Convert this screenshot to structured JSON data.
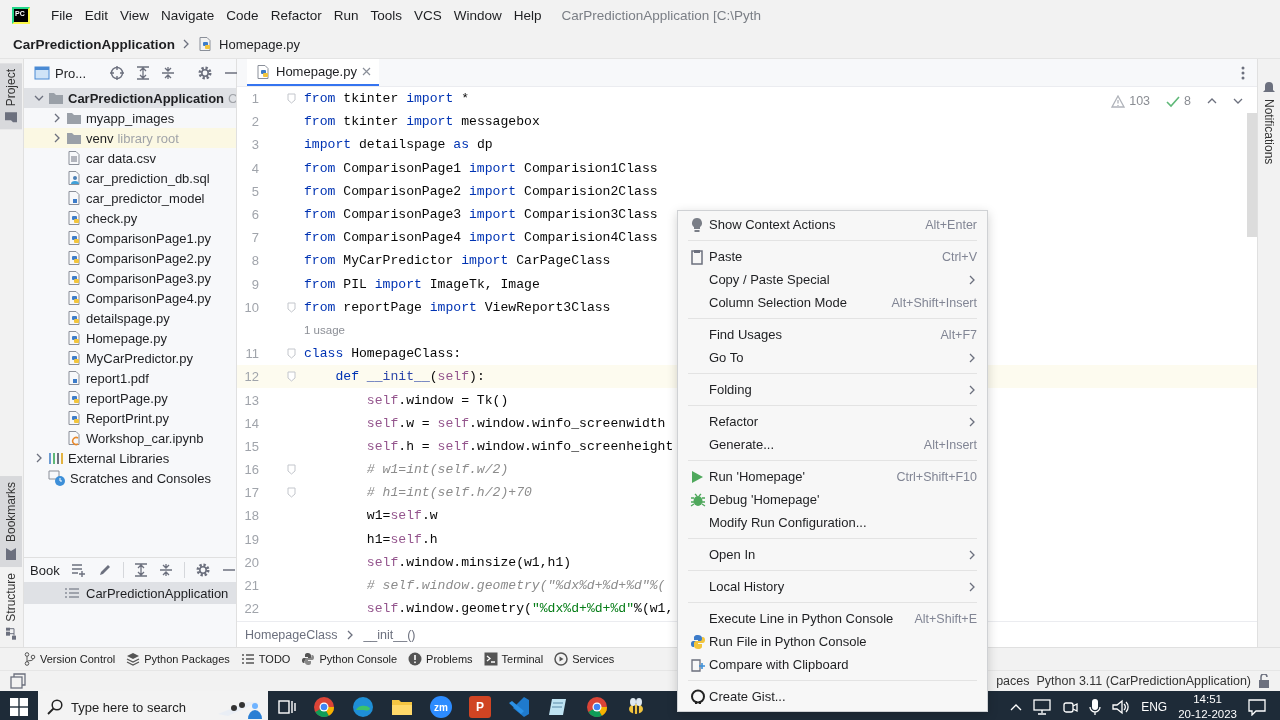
{
  "menubar": {
    "logo_text": "PC",
    "items": [
      "File",
      "Edit",
      "View",
      "Navigate",
      "Code",
      "Refactor",
      "Run",
      "Tools",
      "VCS",
      "Window",
      "Help"
    ],
    "title": "CarPredictionApplication [C:\\Pyth"
  },
  "breadcrumb": {
    "project": "CarPredictionApplication",
    "file": "Homepage.py"
  },
  "left_stripe": [
    {
      "label": "Project",
      "kind": "project",
      "active": true
    },
    {
      "label": "Bookmarks",
      "kind": "bookmarks",
      "active": true
    },
    {
      "label": "Structure",
      "kind": "structure",
      "active": false
    }
  ],
  "project_panel": {
    "title": "Pro...",
    "tree": [
      {
        "label": "CarPredictionApplication",
        "hint": "C",
        "kind": "project-folder",
        "expanded": true,
        "selected": true,
        "children": [
          {
            "label": "myapp_images",
            "kind": "folder",
            "expanded": false,
            "selected": false
          },
          {
            "label": "venv",
            "hint": "library root",
            "kind": "library-folder",
            "expanded": false,
            "selected": false
          },
          {
            "label": "car data.csv",
            "kind": "text",
            "selected": false
          },
          {
            "label": "car_prediction_db.sql",
            "kind": "sql",
            "selected": false
          },
          {
            "label": "car_predictor_model",
            "kind": "unknown",
            "selected": false
          },
          {
            "label": "check.py",
            "kind": "python",
            "selected": false
          },
          {
            "label": "ComparisonPage1.py",
            "kind": "python",
            "selected": false
          },
          {
            "label": "ComparisonPage2.py",
            "kind": "python",
            "selected": false
          },
          {
            "label": "ComparisonPage3.py",
            "kind": "python",
            "selected": false
          },
          {
            "label": "ComparisonPage4.py",
            "kind": "python",
            "selected": false
          },
          {
            "label": "detailspage.py",
            "kind": "python",
            "selected": false
          },
          {
            "label": "Homepage.py",
            "kind": "python",
            "selected": false
          },
          {
            "label": "MyCarPredictor.py",
            "kind": "python",
            "selected": false
          },
          {
            "label": "report1.pdf",
            "kind": "unknown",
            "selected": false
          },
          {
            "label": "reportPage.py",
            "kind": "python",
            "selected": false
          },
          {
            "label": "ReportPrint.py",
            "kind": "python",
            "selected": false
          },
          {
            "label": "Workshop_car.ipynb",
            "kind": "notebook",
            "selected": false
          }
        ]
      },
      {
        "label": "External Libraries",
        "kind": "libraries",
        "expanded": false,
        "selected": false
      },
      {
        "label": "Scratches and Consoles",
        "kind": "scratches",
        "selected": false
      }
    ]
  },
  "bookmarks_panel": {
    "title": "Book",
    "items": [
      {
        "label": "CarPredictionApplication",
        "selected": true
      }
    ]
  },
  "editor": {
    "tabs": [
      {
        "label": "Homepage.py",
        "selected": true
      }
    ],
    "inspections": {
      "warnings": "103",
      "weak_warnings": "8"
    },
    "lines": [
      {
        "kind": "code",
        "number": "1",
        "fold": true,
        "current": false,
        "segments": [
          {
            "text": "from",
            "kind": "keyword"
          },
          {
            "text": " tkinter ",
            "kind": "plain"
          },
          {
            "text": "import",
            "kind": "keyword"
          },
          {
            "text": " *",
            "kind": "plain"
          }
        ]
      },
      {
        "kind": "code",
        "number": "2",
        "fold": false,
        "current": false,
        "segments": [
          {
            "text": "from",
            "kind": "keyword"
          },
          {
            "text": " tkinter ",
            "kind": "plain"
          },
          {
            "text": "import",
            "kind": "keyword"
          },
          {
            "text": " messagebox",
            "kind": "plain"
          }
        ]
      },
      {
        "kind": "code",
        "number": "3",
        "fold": false,
        "current": false,
        "segments": [
          {
            "text": "import",
            "kind": "keyword"
          },
          {
            "text": " detailspage ",
            "kind": "plain"
          },
          {
            "text": "as",
            "kind": "keyword"
          },
          {
            "text": " dp",
            "kind": "plain"
          }
        ]
      },
      {
        "kind": "code",
        "number": "4",
        "fold": false,
        "current": false,
        "segments": [
          {
            "text": "from",
            "kind": "keyword"
          },
          {
            "text": " ComparisonPage1 ",
            "kind": "plain"
          },
          {
            "text": "import",
            "kind": "keyword"
          },
          {
            "text": " Comparision1Class",
            "kind": "plain"
          }
        ]
      },
      {
        "kind": "code",
        "number": "5",
        "fold": false,
        "current": false,
        "segments": [
          {
            "text": "from",
            "kind": "keyword"
          },
          {
            "text": " ComparisonPage2 ",
            "kind": "plain"
          },
          {
            "text": "import",
            "kind": "keyword"
          },
          {
            "text": " Comparision2Class",
            "kind": "plain"
          }
        ]
      },
      {
        "kind": "code",
        "number": "6",
        "fold": false,
        "current": false,
        "segments": [
          {
            "text": "from",
            "kind": "keyword"
          },
          {
            "text": " ComparisonPage3 ",
            "kind": "plain"
          },
          {
            "text": "import",
            "kind": "keyword"
          },
          {
            "text": " Comparision3Class",
            "kind": "plain"
          }
        ]
      },
      {
        "kind": "code",
        "number": "7",
        "fold": false,
        "current": false,
        "segments": [
          {
            "text": "from",
            "kind": "keyword"
          },
          {
            "text": " ComparisonPage4 ",
            "kind": "plain"
          },
          {
            "text": "import",
            "kind": "keyword"
          },
          {
            "text": " Comparision4Class",
            "kind": "plain"
          }
        ]
      },
      {
        "kind": "code",
        "number": "8",
        "fold": false,
        "current": false,
        "segments": [
          {
            "text": "from",
            "kind": "keyword"
          },
          {
            "text": " MyCarPredictor ",
            "kind": "plain"
          },
          {
            "text": "import",
            "kind": "keyword"
          },
          {
            "text": " CarPageClass",
            "kind": "plain"
          }
        ]
      },
      {
        "kind": "code",
        "number": "9",
        "fold": false,
        "current": false,
        "segments": [
          {
            "text": "from",
            "kind": "keyword"
          },
          {
            "text": " PIL ",
            "kind": "plain"
          },
          {
            "text": "import",
            "kind": "keyword"
          },
          {
            "text": " ImageTk, Image",
            "kind": "plain"
          }
        ]
      },
      {
        "kind": "code",
        "number": "10",
        "fold": true,
        "current": false,
        "segments": [
          {
            "text": "from",
            "kind": "keyword"
          },
          {
            "text": " reportPage ",
            "kind": "plain"
          },
          {
            "text": "import",
            "kind": "keyword"
          },
          {
            "text": " ViewReport3Class",
            "kind": "plain"
          }
        ]
      },
      {
        "kind": "inlay",
        "text": "1 usage"
      },
      {
        "kind": "code",
        "number": "11",
        "fold": true,
        "current": false,
        "segments": [
          {
            "text": "class",
            "kind": "keyword"
          },
          {
            "text": " HomepageClass:",
            "kind": "plain"
          }
        ]
      },
      {
        "kind": "code",
        "number": "12",
        "fold": true,
        "current": true,
        "segments": [
          {
            "text": "    def",
            "kind": "keyword"
          },
          {
            "text": " __init__",
            "kind": "special"
          },
          {
            "text": "(",
            "kind": "plain"
          },
          {
            "text": "self",
            "kind": "self"
          },
          {
            "text": "):",
            "kind": "plain"
          }
        ]
      },
      {
        "kind": "code",
        "number": "13",
        "fold": false,
        "current": false,
        "segments": [
          {
            "text": "        self",
            "kind": "self"
          },
          {
            "text": ".window = Tk()",
            "kind": "plain"
          }
        ]
      },
      {
        "kind": "code",
        "number": "14",
        "fold": false,
        "current": false,
        "segments": [
          {
            "text": "        self",
            "kind": "self"
          },
          {
            "text": ".w = ",
            "kind": "plain"
          },
          {
            "text": "self",
            "kind": "self"
          },
          {
            "text": ".window.winfo_screenwidth",
            "kind": "plain"
          }
        ]
      },
      {
        "kind": "code",
        "number": "15",
        "fold": false,
        "current": false,
        "segments": [
          {
            "text": "        self",
            "kind": "self"
          },
          {
            "text": ".h = ",
            "kind": "plain"
          },
          {
            "text": "self",
            "kind": "self"
          },
          {
            "text": ".window.winfo_screenheight",
            "kind": "plain"
          }
        ]
      },
      {
        "kind": "code",
        "number": "16",
        "fold": true,
        "current": false,
        "segments": [
          {
            "text": "        # w1=int(self.w/2)",
            "kind": "comment"
          }
        ]
      },
      {
        "kind": "code",
        "number": "17",
        "fold": true,
        "current": false,
        "segments": [
          {
            "text": "        # h1=int(self.h/2)+70",
            "kind": "comment"
          }
        ]
      },
      {
        "kind": "code",
        "number": "18",
        "fold": false,
        "current": false,
        "segments": [
          {
            "text": "        w1=",
            "kind": "plain"
          },
          {
            "text": "self",
            "kind": "self"
          },
          {
            "text": ".w",
            "kind": "plain"
          }
        ]
      },
      {
        "kind": "code",
        "number": "19",
        "fold": false,
        "current": false,
        "segments": [
          {
            "text": "        h1=",
            "kind": "plain"
          },
          {
            "text": "self",
            "kind": "self"
          },
          {
            "text": ".h",
            "kind": "plain"
          }
        ]
      },
      {
        "kind": "code",
        "number": "20",
        "fold": false,
        "current": false,
        "segments": [
          {
            "text": "        self",
            "kind": "self"
          },
          {
            "text": ".window.minsize(w1,h1)",
            "kind": "plain"
          }
        ]
      },
      {
        "kind": "code",
        "number": "21",
        "fold": false,
        "current": false,
        "segments": [
          {
            "text": "        # self.window.geometry(\"%dx%d+%d+%d\"%(",
            "kind": "comment"
          }
        ]
      },
      {
        "kind": "code",
        "number": "22",
        "fold": false,
        "current": false,
        "segments": [
          {
            "text": "        self",
            "kind": "self"
          },
          {
            "text": ".window.geometry(",
            "kind": "plain"
          },
          {
            "text": "\"%dx%d+%d+%d\"",
            "kind": "string"
          },
          {
            "text": "%(w1,",
            "kind": "plain"
          }
        ]
      }
    ],
    "breadcrumb": [
      "HomepageClass",
      "__init__()"
    ]
  },
  "context_menu": {
    "groups": [
      [
        {
          "label": "Show Context Actions",
          "kind": "bulb",
          "shortcut": "Alt+Enter",
          "submenu": false
        }
      ],
      [
        {
          "label": "Paste",
          "kind": "clipboard",
          "shortcut": "Ctrl+V",
          "submenu": false
        },
        {
          "label": "Copy / Paste Special",
          "submenu": true
        },
        {
          "label": "Column Selection Mode",
          "shortcut": "Alt+Shift+Insert",
          "submenu": false
        }
      ],
      [
        {
          "label": "Find Usages",
          "shortcut": "Alt+F7",
          "submenu": false
        },
        {
          "label": "Go To",
          "submenu": true
        }
      ],
      [
        {
          "label": "Folding",
          "submenu": true
        }
      ],
      [
        {
          "label": "Refactor",
          "submenu": true
        },
        {
          "label": "Generate...",
          "shortcut": "Alt+Insert",
          "submenu": false
        }
      ],
      [
        {
          "label": "Run 'Homepage'",
          "kind": "run",
          "shortcut": "Ctrl+Shift+F10",
          "submenu": false
        },
        {
          "label": "Debug 'Homepage'",
          "kind": "bug",
          "submenu": false
        },
        {
          "label": "Modify Run Configuration...",
          "submenu": false
        }
      ],
      [
        {
          "label": "Open In",
          "submenu": true
        }
      ],
      [
        {
          "label": "Local History",
          "submenu": true
        }
      ],
      [
        {
          "label": "Execute Line in Python Console",
          "shortcut": "Alt+Shift+E",
          "submenu": false
        },
        {
          "label": "Run File in Python Console",
          "kind": "python",
          "submenu": false
        },
        {
          "label": "Compare with Clipboard",
          "kind": "compare",
          "submenu": false
        }
      ],
      [
        {
          "label": "Create Gist...",
          "kind": "github",
          "submenu": false
        }
      ]
    ]
  },
  "tool_strip": [
    {
      "label": "Version Control",
      "kind": "branch"
    },
    {
      "label": "Python Packages",
      "kind": "layers"
    },
    {
      "label": "TODO",
      "kind": "todo"
    },
    {
      "label": "Python Console",
      "kind": "python-dark"
    },
    {
      "label": "Problems",
      "kind": "problems"
    },
    {
      "label": "Terminal",
      "kind": "terminal"
    },
    {
      "label": "Services",
      "kind": "services"
    }
  ],
  "status_bar": {
    "indent": "paces",
    "interpreter": "Python 3.11 (CarPredictionApplication)"
  },
  "right_stripe": {
    "label": "Notifications"
  },
  "taskbar": {
    "search_placeholder": "Type here to search",
    "apps": [
      {
        "kind": "taskview"
      },
      {
        "kind": "round-browser"
      },
      {
        "kind": "wave-browser"
      },
      {
        "kind": "files"
      },
      {
        "kind": "label-round",
        "label": "zm",
        "color": "#2d8cff"
      },
      {
        "kind": "label-square",
        "label": "P",
        "color": "#d04423"
      },
      {
        "kind": "code-editor"
      },
      {
        "kind": "notepad"
      },
      {
        "kind": "round-browser"
      },
      {
        "kind": "bee"
      }
    ],
    "language": "ENG",
    "time": "14:51",
    "date": "20-12-2023"
  }
}
